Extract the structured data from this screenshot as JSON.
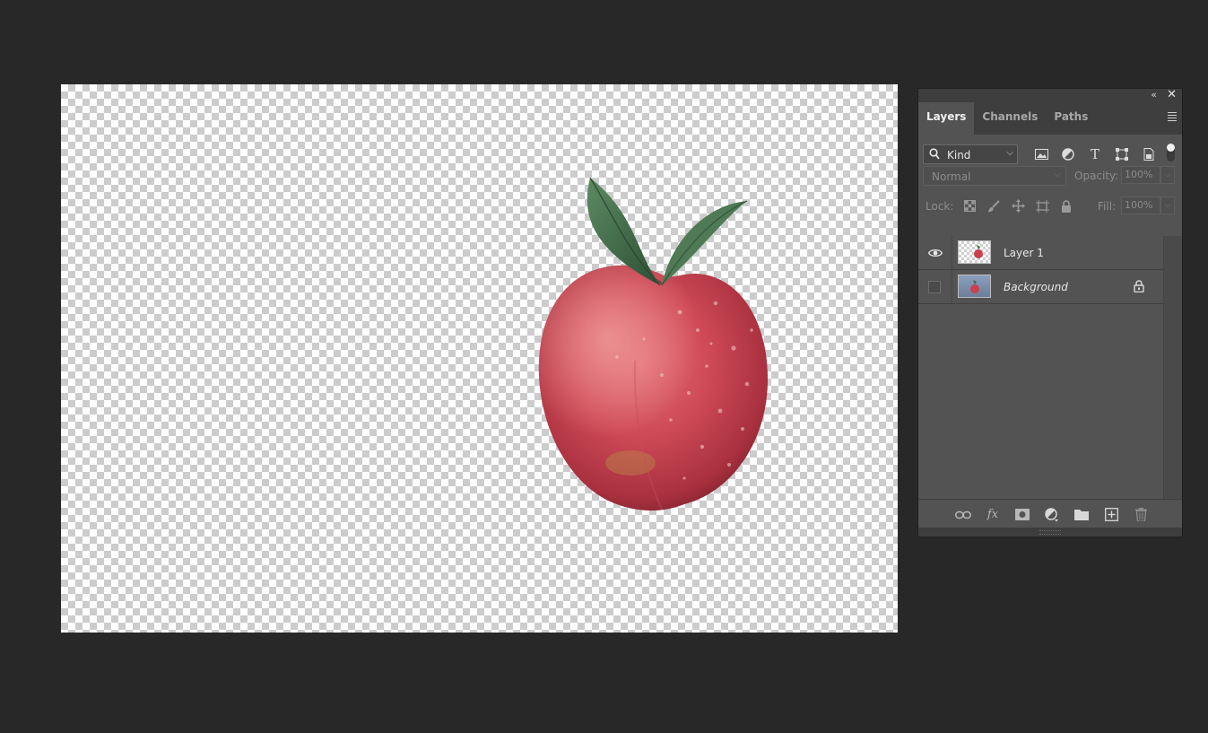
{
  "canvas": {
    "content": "apple-with-leaves-on-transparent-background"
  },
  "layers_panel": {
    "tabs": [
      {
        "label": "Layers",
        "active": true
      },
      {
        "label": "Channels",
        "active": false
      },
      {
        "label": "Paths",
        "active": false
      }
    ],
    "filter": {
      "kind_label": "Kind",
      "icons": [
        "image-filter-icon",
        "adjustment-filter-icon",
        "type-filter-icon",
        "shape-filter-icon",
        "smart-object-filter-icon"
      ]
    },
    "blend_mode": "Normal",
    "opacity_label": "Opacity:",
    "opacity_value": "100%",
    "lock_label": "Lock:",
    "fill_label": "Fill:",
    "fill_value": "100%",
    "layers": [
      {
        "name": "Layer 1",
        "visible": true,
        "locked": false
      },
      {
        "name": "Background",
        "visible": false,
        "locked": true
      }
    ],
    "bottom_icons": [
      "link-layers-icon",
      "fx-icon",
      "layer-mask-icon",
      "adjustment-layer-icon",
      "group-folder-icon",
      "new-layer-icon",
      "trash-icon"
    ]
  },
  "colors": {
    "app_background": "#282828",
    "panel_background": "#535353",
    "panel_header": "#3e3e3e"
  }
}
